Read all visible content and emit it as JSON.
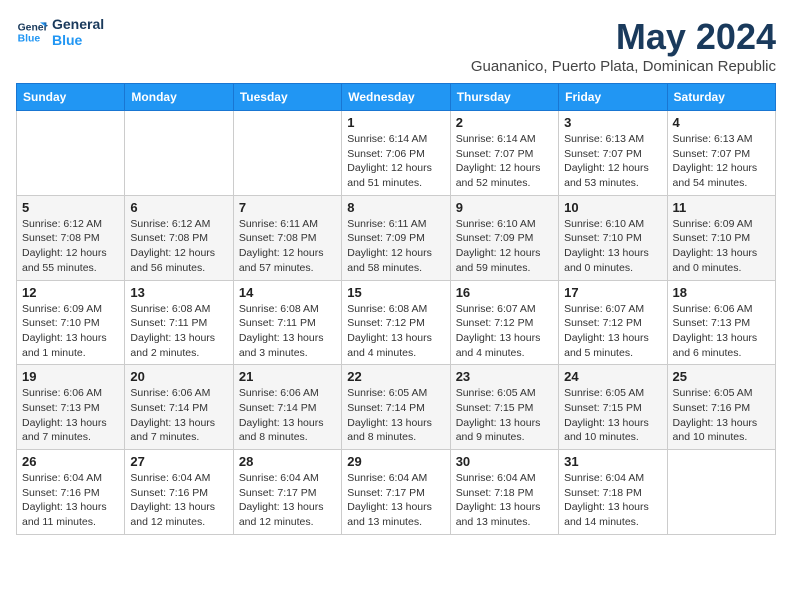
{
  "logo": {
    "line1": "General",
    "line2": "Blue"
  },
  "title": "May 2024",
  "location": "Guananico, Puerto Plata, Dominican Republic",
  "days": [
    "Sunday",
    "Monday",
    "Tuesday",
    "Wednesday",
    "Thursday",
    "Friday",
    "Saturday"
  ],
  "weeks": [
    [
      {
        "date": "",
        "info": ""
      },
      {
        "date": "",
        "info": ""
      },
      {
        "date": "",
        "info": ""
      },
      {
        "date": "1",
        "info": "Sunrise: 6:14 AM\nSunset: 7:06 PM\nDaylight: 12 hours\nand 51 minutes."
      },
      {
        "date": "2",
        "info": "Sunrise: 6:14 AM\nSunset: 7:07 PM\nDaylight: 12 hours\nand 52 minutes."
      },
      {
        "date": "3",
        "info": "Sunrise: 6:13 AM\nSunset: 7:07 PM\nDaylight: 12 hours\nand 53 minutes."
      },
      {
        "date": "4",
        "info": "Sunrise: 6:13 AM\nSunset: 7:07 PM\nDaylight: 12 hours\nand 54 minutes."
      }
    ],
    [
      {
        "date": "5",
        "info": "Sunrise: 6:12 AM\nSunset: 7:08 PM\nDaylight: 12 hours\nand 55 minutes."
      },
      {
        "date": "6",
        "info": "Sunrise: 6:12 AM\nSunset: 7:08 PM\nDaylight: 12 hours\nand 56 minutes."
      },
      {
        "date": "7",
        "info": "Sunrise: 6:11 AM\nSunset: 7:08 PM\nDaylight: 12 hours\nand 57 minutes."
      },
      {
        "date": "8",
        "info": "Sunrise: 6:11 AM\nSunset: 7:09 PM\nDaylight: 12 hours\nand 58 minutes."
      },
      {
        "date": "9",
        "info": "Sunrise: 6:10 AM\nSunset: 7:09 PM\nDaylight: 12 hours\nand 59 minutes."
      },
      {
        "date": "10",
        "info": "Sunrise: 6:10 AM\nSunset: 7:10 PM\nDaylight: 13 hours\nand 0 minutes."
      },
      {
        "date": "11",
        "info": "Sunrise: 6:09 AM\nSunset: 7:10 PM\nDaylight: 13 hours\nand 0 minutes."
      }
    ],
    [
      {
        "date": "12",
        "info": "Sunrise: 6:09 AM\nSunset: 7:10 PM\nDaylight: 13 hours\nand 1 minute."
      },
      {
        "date": "13",
        "info": "Sunrise: 6:08 AM\nSunset: 7:11 PM\nDaylight: 13 hours\nand 2 minutes."
      },
      {
        "date": "14",
        "info": "Sunrise: 6:08 AM\nSunset: 7:11 PM\nDaylight: 13 hours\nand 3 minutes."
      },
      {
        "date": "15",
        "info": "Sunrise: 6:08 AM\nSunset: 7:12 PM\nDaylight: 13 hours\nand 4 minutes."
      },
      {
        "date": "16",
        "info": "Sunrise: 6:07 AM\nSunset: 7:12 PM\nDaylight: 13 hours\nand 4 minutes."
      },
      {
        "date": "17",
        "info": "Sunrise: 6:07 AM\nSunset: 7:12 PM\nDaylight: 13 hours\nand 5 minutes."
      },
      {
        "date": "18",
        "info": "Sunrise: 6:06 AM\nSunset: 7:13 PM\nDaylight: 13 hours\nand 6 minutes."
      }
    ],
    [
      {
        "date": "19",
        "info": "Sunrise: 6:06 AM\nSunset: 7:13 PM\nDaylight: 13 hours\nand 7 minutes."
      },
      {
        "date": "20",
        "info": "Sunrise: 6:06 AM\nSunset: 7:14 PM\nDaylight: 13 hours\nand 7 minutes."
      },
      {
        "date": "21",
        "info": "Sunrise: 6:06 AM\nSunset: 7:14 PM\nDaylight: 13 hours\nand 8 minutes."
      },
      {
        "date": "22",
        "info": "Sunrise: 6:05 AM\nSunset: 7:14 PM\nDaylight: 13 hours\nand 8 minutes."
      },
      {
        "date": "23",
        "info": "Sunrise: 6:05 AM\nSunset: 7:15 PM\nDaylight: 13 hours\nand 9 minutes."
      },
      {
        "date": "24",
        "info": "Sunrise: 6:05 AM\nSunset: 7:15 PM\nDaylight: 13 hours\nand 10 minutes."
      },
      {
        "date": "25",
        "info": "Sunrise: 6:05 AM\nSunset: 7:16 PM\nDaylight: 13 hours\nand 10 minutes."
      }
    ],
    [
      {
        "date": "26",
        "info": "Sunrise: 6:04 AM\nSunset: 7:16 PM\nDaylight: 13 hours\nand 11 minutes."
      },
      {
        "date": "27",
        "info": "Sunrise: 6:04 AM\nSunset: 7:16 PM\nDaylight: 13 hours\nand 12 minutes."
      },
      {
        "date": "28",
        "info": "Sunrise: 6:04 AM\nSunset: 7:17 PM\nDaylight: 13 hours\nand 12 minutes."
      },
      {
        "date": "29",
        "info": "Sunrise: 6:04 AM\nSunset: 7:17 PM\nDaylight: 13 hours\nand 13 minutes."
      },
      {
        "date": "30",
        "info": "Sunrise: 6:04 AM\nSunset: 7:18 PM\nDaylight: 13 hours\nand 13 minutes."
      },
      {
        "date": "31",
        "info": "Sunrise: 6:04 AM\nSunset: 7:18 PM\nDaylight: 13 hours\nand 14 minutes."
      },
      {
        "date": "",
        "info": ""
      }
    ]
  ]
}
